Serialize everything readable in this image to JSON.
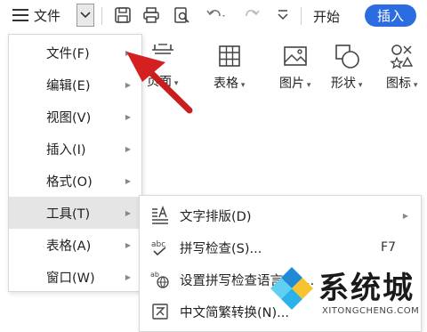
{
  "toolbar": {
    "file_label": "文件",
    "quick_access_icons": [
      "save-icon",
      "print-icon",
      "print-preview-icon",
      "undo-icon",
      "redo-icon",
      "customize-icon"
    ],
    "tab_start": "开始",
    "tab_insert": "插入",
    "accent_color": "#2b6de0"
  },
  "ribbon": {
    "items": [
      {
        "label": "页面",
        "icon": "page-icon"
      },
      {
        "label": "表格",
        "icon": "table-icon"
      },
      {
        "label": "图片",
        "icon": "picture-icon"
      },
      {
        "label": "形状",
        "icon": "shapes-icon"
      },
      {
        "label": "图标",
        "icon": "icons-icon"
      }
    ]
  },
  "menu": {
    "items": [
      {
        "label": "文件(F)"
      },
      {
        "label": "编辑(E)"
      },
      {
        "label": "视图(V)"
      },
      {
        "label": "插入(I)"
      },
      {
        "label": "格式(O)"
      },
      {
        "label": "工具(T)",
        "active": true
      },
      {
        "label": "表格(A)"
      },
      {
        "label": "窗口(W)"
      }
    ]
  },
  "submenu": {
    "items": [
      {
        "label": "文字排版(D)",
        "icon": "text-layout-icon",
        "shortcut": "",
        "has_submenu": true
      },
      {
        "label": "拼写检查(S)...",
        "icon": "spellcheck-icon",
        "shortcut": "F7"
      },
      {
        "label": "设置拼写检查语言(C)...",
        "icon": "spellcheck-language-icon",
        "shortcut": ""
      },
      {
        "label": "中文简繁转换(N)...",
        "icon": "chinese-convert-icon",
        "shortcut": ""
      }
    ]
  },
  "watermark": {
    "cn": "系统城",
    "en": "XITONGCHENG.COM"
  }
}
